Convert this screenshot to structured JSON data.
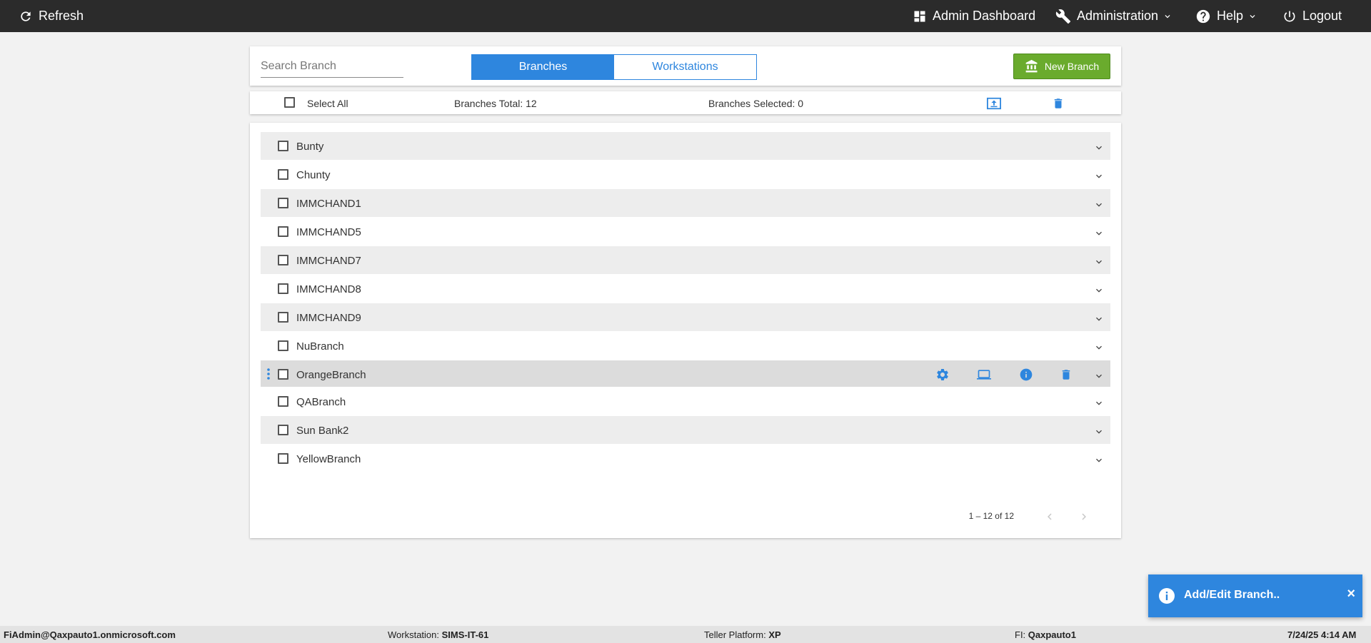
{
  "topbar": {
    "refresh_label": "Refresh",
    "admin_dashboard_label": "Admin Dashboard",
    "administration_label": "Administration",
    "help_label": "Help",
    "logout_label": "Logout"
  },
  "toolbar": {
    "search_placeholder": "Search Branch",
    "tabs": [
      {
        "label": "Branches",
        "active": true
      },
      {
        "label": "Workstations",
        "active": false
      }
    ],
    "new_branch_label": "New Branch"
  },
  "selectbar": {
    "select_all_label": "Select All",
    "total_label": "Branches Total: 12",
    "selected_label": "Branches Selected: 0"
  },
  "branches": [
    {
      "name": "Bunty"
    },
    {
      "name": "Chunty"
    },
    {
      "name": "IMMCHAND1"
    },
    {
      "name": "IMMCHAND5"
    },
    {
      "name": "IMMCHAND7"
    },
    {
      "name": "IMMCHAND8"
    },
    {
      "name": "IMMCHAND9"
    },
    {
      "name": "NuBranch"
    },
    {
      "name": "OrangeBranch"
    },
    {
      "name": "QABranch"
    },
    {
      "name": "Sun Bank2"
    },
    {
      "name": "YellowBranch"
    }
  ],
  "pager": {
    "range_label": "1 – 12 of 12"
  },
  "toast": {
    "message": "Add/Edit Branch..",
    "close_glyph": "×"
  },
  "statusbar": {
    "user": "FiAdmin@Qaxpauto1.onmicrosoft.com",
    "workstation_label": "Workstation:",
    "workstation_value": "SIMS-IT-61",
    "platform_label": "Teller Platform:",
    "platform_value": "XP",
    "fi_label": "FI:",
    "fi_value": "Qaxpauto1",
    "datetime": "7/24/25 4:14 AM"
  },
  "colors": {
    "accent": "#2e86de",
    "new_branch": "#6aab2d",
    "topbar": "#2b2b2b"
  }
}
